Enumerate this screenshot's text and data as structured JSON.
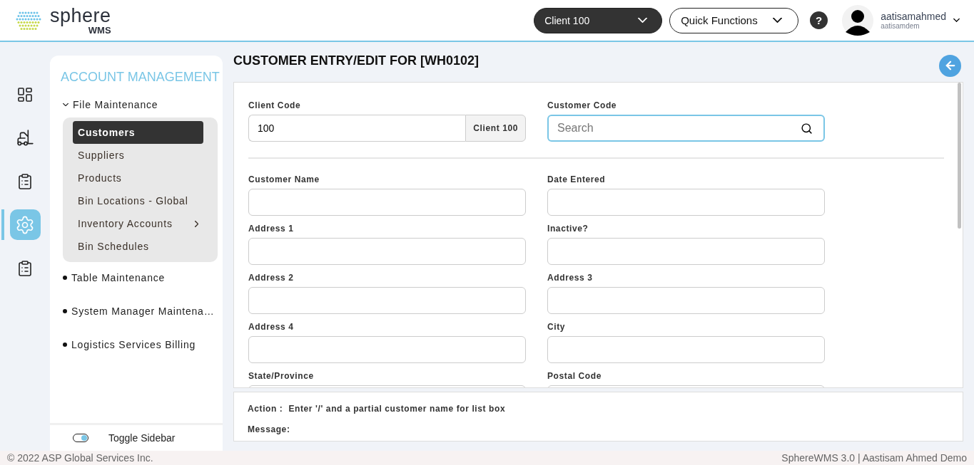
{
  "header": {
    "logo_text": "sphere",
    "logo_subtext": "WMS",
    "client_selector": "Client 100",
    "quick_functions": "Quick Functions",
    "help": "?",
    "user": {
      "name": "aatisamahmed",
      "login": "aatisamdem"
    }
  },
  "icon_rail": [
    {
      "selected": false
    },
    {
      "selected": false
    },
    {
      "selected": false
    },
    {
      "selected": true
    },
    {
      "selected": false
    }
  ],
  "sidebar": {
    "title": "ACCOUNT MANAGEMENT",
    "groups": [
      {
        "label": "File Maintenance",
        "expanded": true,
        "children": [
          {
            "label": "Customers",
            "selected": true,
            "has_submenu": false
          },
          {
            "label": "Suppliers",
            "selected": false,
            "has_submenu": false
          },
          {
            "label": "Products",
            "selected": false,
            "has_submenu": false
          },
          {
            "label": "Bin Locations - Global",
            "selected": false,
            "has_submenu": false
          },
          {
            "label": "Inventory Accounts",
            "selected": false,
            "has_submenu": true
          },
          {
            "label": "Bin Schedules",
            "selected": false,
            "has_submenu": false
          }
        ]
      },
      {
        "label": "Table Maintenance",
        "expanded": false
      },
      {
        "label": "System Manager Maintena…",
        "expanded": false
      },
      {
        "label": "Logistics Services Billing",
        "expanded": false
      }
    ],
    "toggle": {
      "label": "Toggle Sidebar",
      "on": true
    }
  },
  "page": {
    "title": "CUSTOMER ENTRY/EDIT FOR [WH0102]"
  },
  "form": {
    "client_code": {
      "label": "Client Code",
      "value": "100",
      "addon": "Client 100"
    },
    "customer_code": {
      "label": "Customer Code",
      "placeholder": "Search"
    },
    "fields": [
      {
        "label": "Customer Name"
      },
      {
        "label": "Date Entered"
      },
      {
        "label": "Address 1"
      },
      {
        "label": "Inactive?"
      },
      {
        "label": "Address 2"
      },
      {
        "label": "Address 3"
      },
      {
        "label": "Address 4"
      },
      {
        "label": "City"
      },
      {
        "label": "State/Province"
      },
      {
        "label": "Postal Code"
      }
    ]
  },
  "status": {
    "action_label": "Action :",
    "action_text": "Enter '/' and a partial customer name for list box",
    "message_label": "Message:"
  },
  "footer": {
    "copyright": "© 2022 ASP Global Services Inc.",
    "version": "SphereWMS 3.0 | Aastisam Ahmed Demo"
  }
}
